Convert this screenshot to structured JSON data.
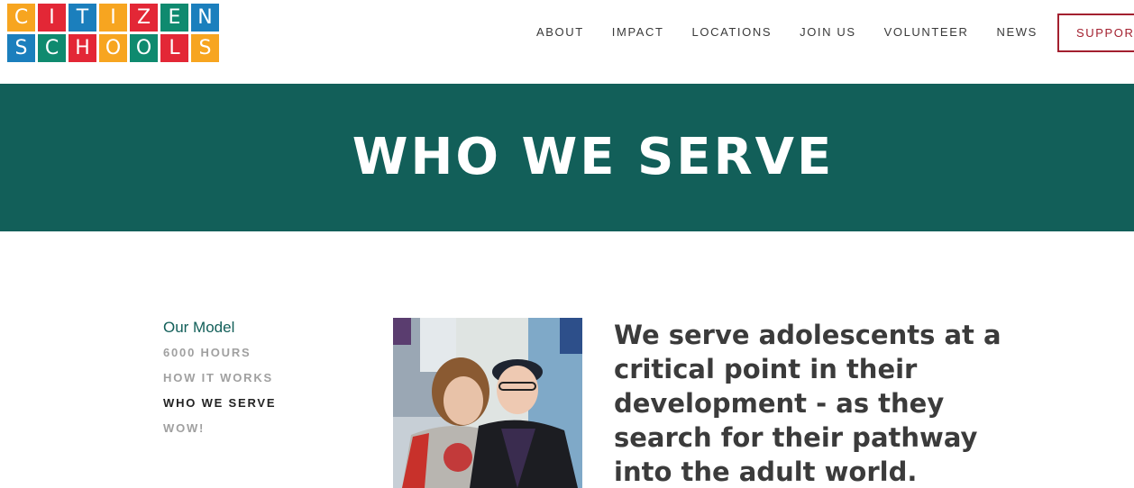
{
  "logo": {
    "row1": [
      {
        "letter": "C",
        "color": "#f7a520"
      },
      {
        "letter": "I",
        "color": "#e32736"
      },
      {
        "letter": "T",
        "color": "#1b7fbd"
      },
      {
        "letter": "I",
        "color": "#f7a520"
      },
      {
        "letter": "Z",
        "color": "#e32736"
      },
      {
        "letter": "E",
        "color": "#0f8a6f"
      },
      {
        "letter": "N",
        "color": "#1b7fbd"
      }
    ],
    "row2": [
      {
        "letter": "S",
        "color": "#1b7fbd"
      },
      {
        "letter": "C",
        "color": "#0f8a6f"
      },
      {
        "letter": "H",
        "color": "#e32736"
      },
      {
        "letter": "O",
        "color": "#f7a520"
      },
      {
        "letter": "O",
        "color": "#0f8a6f"
      },
      {
        "letter": "L",
        "color": "#e32736"
      },
      {
        "letter": "S",
        "color": "#f7a520"
      }
    ]
  },
  "nav": {
    "items": [
      "ABOUT",
      "IMPACT",
      "LOCATIONS",
      "JOIN US",
      "VOLUNTEER",
      "NEWS"
    ],
    "support_label": "SUPPORT"
  },
  "hero": {
    "title": "WHO WE SERVE",
    "background": "#125f59"
  },
  "side_nav": {
    "heading": "Our Model",
    "links": [
      {
        "label": "6000 HOURS",
        "active": false
      },
      {
        "label": "HOW IT WORKS",
        "active": false
      },
      {
        "label": "WHO WE SERVE",
        "active": true
      },
      {
        "label": "WOW!",
        "active": false
      }
    ]
  },
  "intro": {
    "text": "We serve adolescents at a critical point in their development - as they search for their pathway into the adult world."
  },
  "colors": {
    "accent_green": "#125f59",
    "support_red": "#a3202f"
  }
}
